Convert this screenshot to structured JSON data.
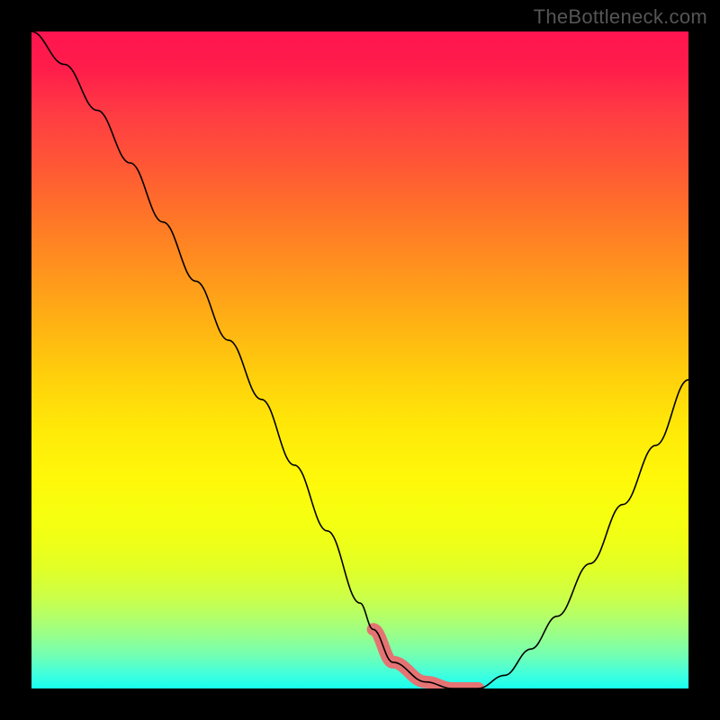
{
  "watermark": "TheBottleneck.com",
  "chart_data": {
    "type": "line",
    "title": "",
    "xlabel": "",
    "ylabel": "",
    "xlim": [
      0,
      100
    ],
    "ylim": [
      0,
      100
    ],
    "series": [
      {
        "name": "curve",
        "x": [
          0,
          5,
          10,
          15,
          20,
          25,
          30,
          35,
          40,
          45,
          50,
          52,
          55,
          60,
          64,
          66,
          68,
          72,
          76,
          80,
          85,
          90,
          95,
          100
        ],
        "values": [
          100,
          95,
          88,
          80,
          71,
          62,
          53,
          44,
          34,
          24,
          13,
          9,
          4,
          1,
          0,
          0,
          0,
          2,
          6,
          11,
          19,
          28,
          37,
          47
        ]
      }
    ],
    "highlight_region": {
      "x_start": 52,
      "x_end": 68
    },
    "colors": {
      "curve": "#000000",
      "highlight": "#e57373",
      "gradient_top": "#ff1450",
      "gradient_bottom": "#18ffee",
      "background": "#000000"
    }
  }
}
